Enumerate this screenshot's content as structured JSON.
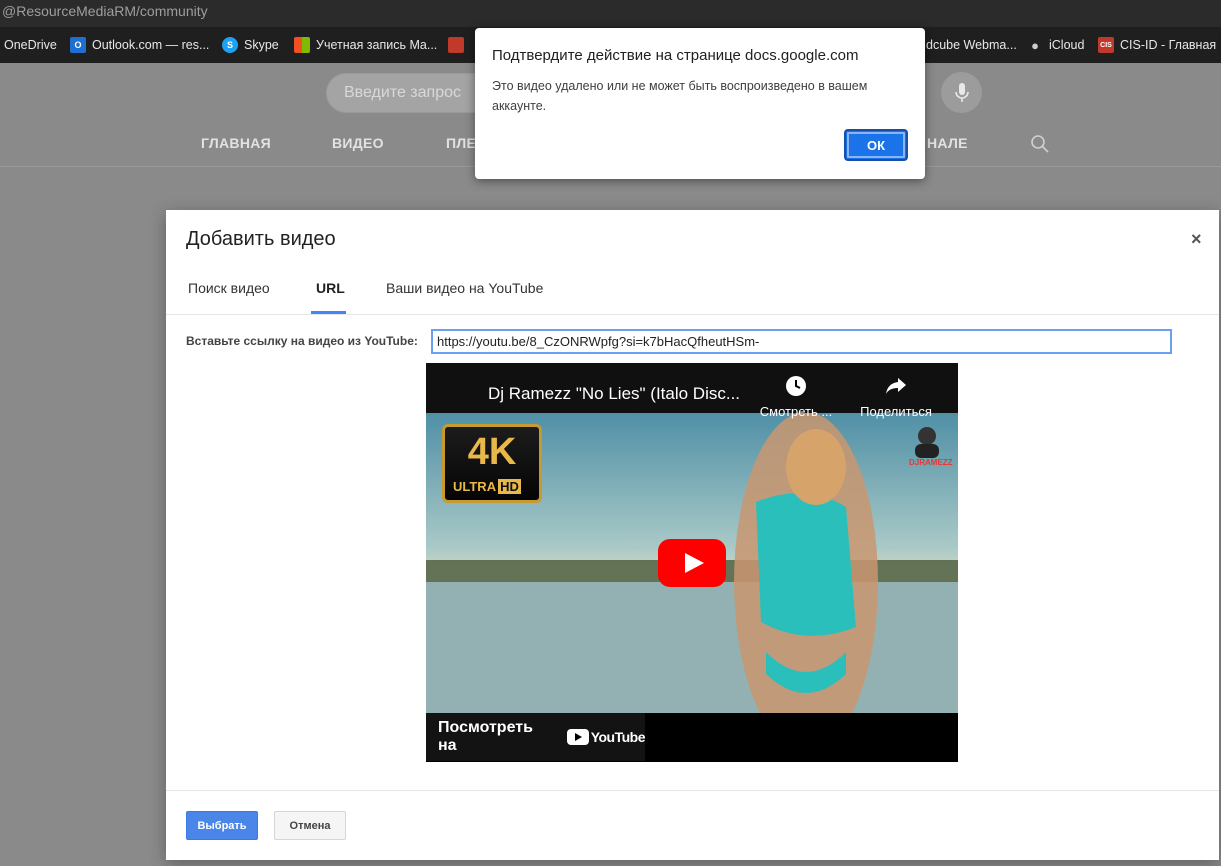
{
  "browser": {
    "url": "@ResourceMediaRM/community",
    "bookmarks": [
      {
        "label": "OneDrive",
        "icon": "onedrive-icon",
        "color": "#1f6fd1"
      },
      {
        "label": "Outlook.com — res...",
        "icon": "outlook-icon",
        "color": "#1f6fd1"
      },
      {
        "label": "Skype",
        "icon": "skype-icon",
        "color": "#1da1f2"
      },
      {
        "label": "Учетная запись Ma...",
        "icon": "microsoft-icon",
        "color": "#f25022"
      },
      {
        "label": "dcube Webma...",
        "icon": "bookmark-icon",
        "color": ""
      },
      {
        "label": "iCloud",
        "icon": "apple-icon",
        "color": "#cccccc"
      },
      {
        "label": "CIS-ID - Главная",
        "icon": "cis-icon",
        "color": "#c0392b"
      }
    ]
  },
  "youtube_page": {
    "search_placeholder": "Введите запрос",
    "tabs": [
      "ГЛАВНАЯ",
      "ВИДЕО",
      "ПЛЕ",
      "НАЛЕ"
    ]
  },
  "alert": {
    "title": "Подтвердите действие на странице docs.google.com",
    "message": "Это видео удалено или не может быть воспроизведено в вашем аккаунте.",
    "ok_label": "ОК"
  },
  "dialog": {
    "title": "Добавить видео",
    "close_label": "×",
    "tabs": [
      {
        "label": "Поиск видео",
        "active": false
      },
      {
        "label": "URL",
        "active": true
      },
      {
        "label": "Ваши видео на YouTube",
        "active": false
      }
    ],
    "url_label": "Вставьте ссылку на видео из YouTube:",
    "url_value": "https://youtu.be/8_CzONRWpfg?si=k7bHacQfheutHSm-",
    "video": {
      "title": "Dj Ramezz \"No Lies\" (Italo Disc...",
      "watch_later_label": "Смотреть ...",
      "share_label": "Поделиться",
      "watch_on_label": "Посмотреть на",
      "youtube_logo_text": "YouTube",
      "badge_big": "4K",
      "badge_small": "ULTRA",
      "badge_hd": "HD",
      "channel_logo_text_a": "DJ",
      "channel_logo_text_b": "RAMEZZ"
    },
    "select_label": "Выбрать",
    "cancel_label": "Отмена"
  },
  "colors": {
    "accent": "#4a86e8",
    "alert_ok": "#1a73e8",
    "youtube_red": "#ff0000"
  }
}
